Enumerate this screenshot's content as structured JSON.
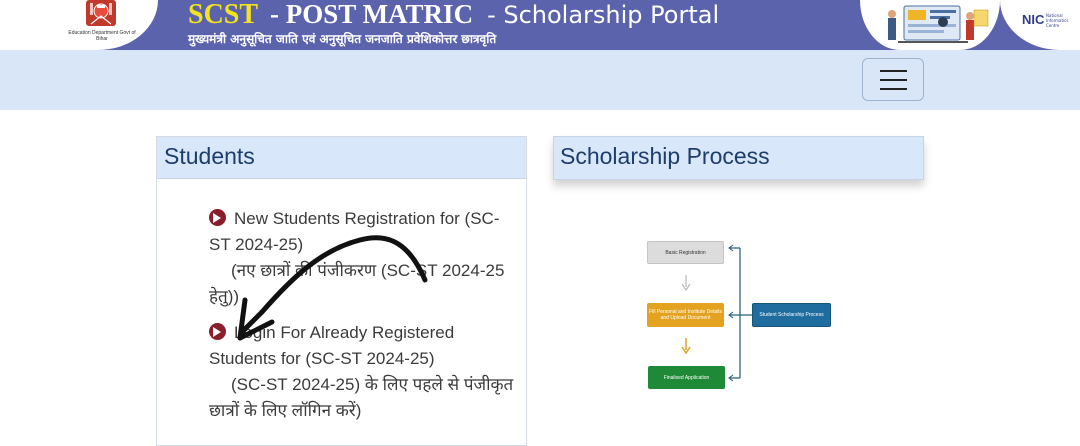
{
  "header": {
    "emblem_text": "Education Department Govt of Bihar",
    "title_scst": "SCST",
    "title_post": "- POST MATRIC",
    "title_portal": "- Scholarship Portal",
    "subtitle": "मुख्यमंत्री अनुसूचित जाति एवं अनुसूचित जनजाति  प्रवेशिकोत्तर छात्रवृति",
    "nic_logo_text": "NIC",
    "nic_logo_sub": "National Informatics Centre"
  },
  "navbar": {
    "menu_icon": "hamburger-menu-icon"
  },
  "students": {
    "title": "Students",
    "items": [
      {
        "icon": "circle-arrow-right-icon",
        "link_text": "New Students Registration for (SC-ST 2024-25)",
        "hindi_text": "(नए छात्रों की पंजीकरण (SC-ST 2024-25 हेतु))"
      },
      {
        "icon": "circle-arrow-right-icon",
        "link_text": "Login For Already Registered Students for (SC-ST 2024-25)",
        "hindi_text": "(SC-ST 2024-25) के लिए पहले से पंजीकृत छात्रों के लिए लॉगिन करें)"
      }
    ]
  },
  "process": {
    "title": "Scholarship Process",
    "flow": {
      "basic": "Basic Registration",
      "fill": "Fill Personal and Institute Details and Upload Document",
      "final": "Finalised Application",
      "student": "Student Scholarship Process"
    }
  },
  "colors": {
    "header_bg": "#5b63ad",
    "scst_yellow": "#f2e21f",
    "nav_bg": "#d8e6f8",
    "card_head": "#d8e7fa",
    "bullet": "#8b1e2b",
    "flow_orange": "#e3a321",
    "flow_green": "#1e8a37",
    "flow_blue": "#1f6d9e"
  }
}
